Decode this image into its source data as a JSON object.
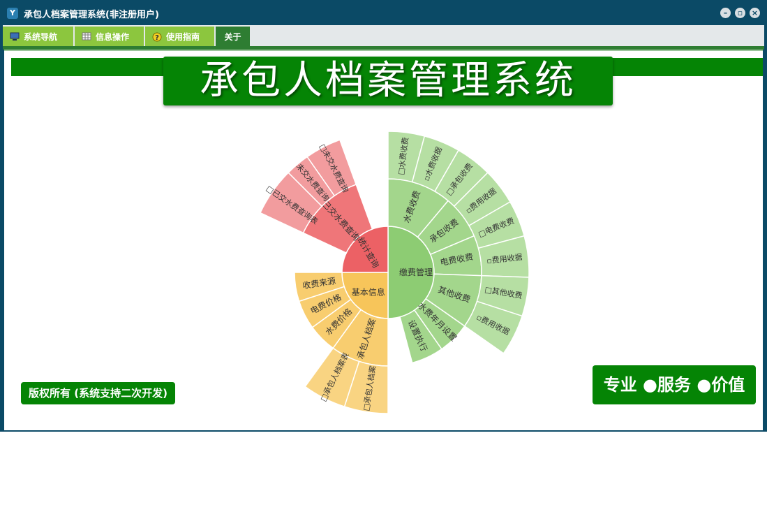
{
  "window": {
    "title": "承包人档案管理系统(非注册用户)",
    "app_icon_letter": "Y",
    "buttons": {
      "minimize": "–",
      "restore": "▫",
      "close": "×"
    }
  },
  "menu": {
    "tabs": [
      {
        "label": "系统导航",
        "icon": "monitor-icon"
      },
      {
        "label": "信息操作",
        "icon": "grid-icon"
      },
      {
        "label": "使用指南",
        "icon": "help-icon"
      },
      {
        "label": "关于",
        "icon": ""
      }
    ],
    "active_index": 3
  },
  "banner": {
    "title": "承包人档案管理系统"
  },
  "footer": {
    "copyright": "版权所有 (系统支持二次开发)",
    "slogan": "专业 ●服务 ●价值"
  },
  "chart_data": {
    "type": "sunburst",
    "colors": {
      "缴费管理": "#8dcc73",
      "基本信息": "#f7c55a",
      "统计查询": "#ec6165"
    },
    "rings": [
      {
        "label": "缴费管理",
        "level": 1,
        "group": "缴费管理",
        "start": -90,
        "end": 90
      },
      {
        "label": "基本信息",
        "level": 1,
        "group": "基本信息",
        "start": 90,
        "end": 180
      },
      {
        "label": "统计查询",
        "level": 1,
        "group": "统计查询",
        "start": 180,
        "end": 270
      },
      {
        "label": "水费收费",
        "level": 2,
        "group": "缴费管理",
        "start": -90,
        "end": -50
      },
      {
        "label": "承包收费",
        "level": 2,
        "group": "缴费管理",
        "start": -50,
        "end": -23
      },
      {
        "label": "电费收费",
        "level": 2,
        "group": "缴费管理",
        "start": -23,
        "end": 2
      },
      {
        "label": "其他收费",
        "level": 2,
        "group": "缴费管理",
        "start": 2,
        "end": 35
      },
      {
        "label": "水费年月设置",
        "level": 2,
        "group": "缴费管理",
        "start": 35,
        "end": 55
      },
      {
        "label": "设置执行",
        "level": 2,
        "group": "缴费管理",
        "start": 55,
        "end": 75
      },
      {
        "label": "收费来源",
        "level": 2,
        "group": "基本信息",
        "start": 162,
        "end": 180
      },
      {
        "label": "电费价格",
        "level": 2,
        "group": "基本信息",
        "start": 144,
        "end": 162
      },
      {
        "label": "水费价格",
        "level": 2,
        "group": "基本信息",
        "start": 126,
        "end": 144
      },
      {
        "label": "承包人档案",
        "level": 2,
        "group": "基本信息",
        "start": 90,
        "end": 126
      },
      {
        "label": "已交水费查询",
        "level": 2,
        "group": "统计查询",
        "start": 205,
        "end": 250
      },
      {
        "label": "□水费收费",
        "level": 3,
        "group": "缴费管理",
        "start": -90,
        "end": -75
      },
      {
        "label": "▫水费收据",
        "level": 3,
        "group": "缴费管理",
        "start": -75,
        "end": -60
      },
      {
        "label": "□承包收费",
        "level": 3,
        "group": "缴费管理",
        "start": -60,
        "end": -45
      },
      {
        "label": "▫费用收据",
        "level": 3,
        "group": "缴费管理",
        "start": -45,
        "end": -30
      },
      {
        "label": "□电费收费",
        "level": 3,
        "group": "缴费管理",
        "start": -30,
        "end": -15
      },
      {
        "label": "▫费用收据",
        "level": 3,
        "group": "缴费管理",
        "start": -15,
        "end": 2
      },
      {
        "label": "□其他收费",
        "level": 3,
        "group": "缴费管理",
        "start": 2,
        "end": 18
      },
      {
        "label": "▫费用收据",
        "level": 3,
        "group": "缴费管理",
        "start": 18,
        "end": 35
      },
      {
        "label": "□承包人档案表",
        "level": 3,
        "group": "基本信息",
        "start": 108,
        "end": 126
      },
      {
        "label": "□承包人档案",
        "level": 3,
        "group": "基本信息",
        "start": 90,
        "end": 108
      },
      {
        "label": "□已交水费查询表",
        "level": 3,
        "group": "统计查询",
        "start": 205,
        "end": 225
      },
      {
        "label": "□未交水费查询",
        "level": 3,
        "group": "统计查询",
        "start": 235,
        "end": 250
      },
      {
        "label": "未交水费查询",
        "level": 3,
        "group": "统计查询",
        "start": 225,
        "end": 235
      }
    ]
  }
}
